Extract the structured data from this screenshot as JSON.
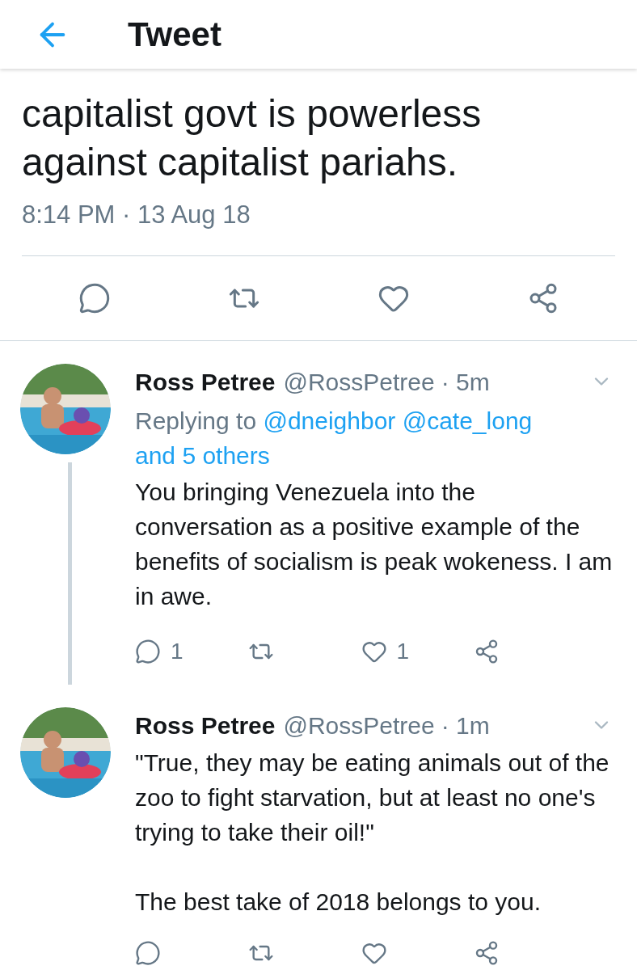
{
  "header": {
    "title": "Tweet"
  },
  "tweet": {
    "text_lines": [
      "capitalist govt is powerless",
      "against capitalist pariahs."
    ],
    "timestamp": "8:14 PM · 13 Aug 18",
    "actions": [
      {
        "kind": "reply"
      },
      {
        "kind": "retweet"
      },
      {
        "kind": "like"
      },
      {
        "kind": "share"
      }
    ]
  },
  "replies": [
    {
      "name": "Ross Petree",
      "handle": "@RossPetree",
      "time": "· 5m",
      "replying_prefix": "Replying to",
      "mentions": [
        "@dneighbor",
        "@cate_long",
        "and 5 others"
      ],
      "paragraphs": [
        "You bringing Venezuela into the conversation as a positive example of the benefits of socialism is peak wokeness. I am in awe."
      ],
      "actions": [
        {
          "kind": "reply",
          "count": "1"
        },
        {
          "kind": "retweet"
        },
        {
          "kind": "like",
          "count": "1"
        },
        {
          "kind": "share"
        }
      ],
      "thread_continues": true
    },
    {
      "name": "Ross Petree",
      "handle": "@RossPetree",
      "time": "· 1m",
      "paragraphs": [
        "\"True, they may be eating animals out of the zoo to fight starvation, but at least no one's trying to take their oil!\"",
        "The best take of 2018 belongs to you."
      ],
      "actions": [
        {
          "kind": "reply"
        },
        {
          "kind": "retweet"
        },
        {
          "kind": "like"
        },
        {
          "kind": "share"
        }
      ],
      "thread_continues": false
    }
  ]
}
